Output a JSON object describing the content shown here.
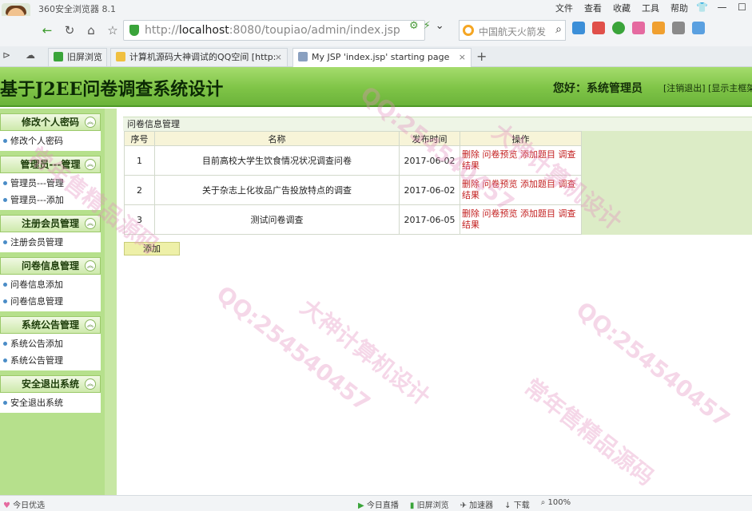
{
  "browser": {
    "app_title": "360安全浏览器 8.1",
    "menus": [
      "文件",
      "查看",
      "收藏",
      "工具",
      "帮助"
    ],
    "url_prefix": "http://",
    "url_host": "localhost",
    "url_rest": ":8080/toupiao/admin/index.jsp",
    "search_text": "中国航天火箭发",
    "tabs": [
      {
        "label": "旧屏浏览"
      },
      {
        "label": "计算机源码大神调试的QQ空间 [http:"
      },
      {
        "label": "My JSP 'index.jsp' starting page"
      }
    ]
  },
  "header": {
    "title": "基于J2EE问卷调查系统设计",
    "greeting": "您好：系统管理员",
    "logout_link": "[注销退出]",
    "frame_link": "[显示主框架]"
  },
  "sidebar": {
    "sections": [
      {
        "title": "修改个人密码",
        "items": [
          "修改个人密码"
        ]
      },
      {
        "title": "管理员---管理",
        "items": [
          "管理员---管理",
          "管理员---添加"
        ]
      },
      {
        "title": "注册会员管理",
        "items": [
          "注册会员管理"
        ]
      },
      {
        "title": "问卷信息管理",
        "items": [
          "问卷信息添加",
          "问卷信息管理"
        ]
      },
      {
        "title": "系统公告管理",
        "items": [
          "系统公告添加",
          "系统公告管理"
        ]
      },
      {
        "title": "安全退出系统",
        "items": [
          "安全退出系统"
        ]
      }
    ]
  },
  "main": {
    "panel_title": "问卷信息管理",
    "columns": [
      "序号",
      "名称",
      "发布时间",
      "操作"
    ],
    "rows": [
      {
        "no": "1",
        "name": "目前高校大学生饮食情况状况调查问卷",
        "date": "2017-06-02",
        "ops": "删除 问卷预览 添加题目 调查结果"
      },
      {
        "no": "2",
        "name": "关于杂志上化妆品广告投放特点的调查",
        "date": "2017-06-02",
        "ops": "删除 问卷预览 添加题目 调查结果"
      },
      {
        "no": "3",
        "name": "测试问卷调查",
        "date": "2017-06-05",
        "ops": "删除 问卷预览 添加题目 调查结果"
      }
    ],
    "add_label": "添加"
  },
  "statusbar": {
    "left": "今日优选",
    "right": [
      "今日直播",
      "旧屏浏览",
      "加速器",
      "下载",
      "100%"
    ]
  },
  "watermarks": [
    "QQ:254540457",
    "大神计算机设计",
    "常年售精品源码"
  ]
}
